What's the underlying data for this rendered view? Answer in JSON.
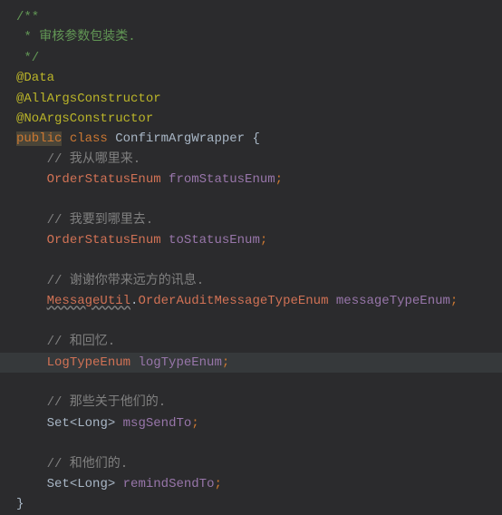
{
  "doc": {
    "open": "/**",
    "l1": " * 审核参数包装类.",
    "close": " */"
  },
  "ann": {
    "data": "@Data",
    "all": "@AllArgsConstructor",
    "no": "@NoArgsConstructor"
  },
  "decl": {
    "pub": "public",
    "cls": "class",
    "name": "ConfirmArgWrapper",
    "open": " {",
    "close": "}"
  },
  "f1": {
    "c": "    // 我从哪里来.",
    "type": "OrderStatusEnum",
    "name": "fromStatusEnum",
    "semi": ";"
  },
  "f2": {
    "c": "    // 我要到哪里去.",
    "type": "OrderStatusEnum",
    "name": "toStatusEnum",
    "semi": ";"
  },
  "f3": {
    "c": "    // 谢谢你带来远方的讯息.",
    "type1": "MessageUtil",
    "dot": ".",
    "type2": "OrderAuditMessageTypeEnum",
    "name": "messageTypeEnum",
    "semi": ";"
  },
  "f4": {
    "c": "    // 和回忆.",
    "type": "LogTypeEnum",
    "name": "logTypeEnum",
    "semi": ";"
  },
  "f5": {
    "c": "    // 那些关于他们的.",
    "type": "Set",
    "lt": "<",
    "gen": "Long",
    "gt": ">",
    "name": "msgSendTo",
    "semi": ";"
  },
  "f6": {
    "c": "    // 和他们的.",
    "type": "Set",
    "lt": "<",
    "gen": "Long",
    "gt": ">",
    "name": "remindSendTo",
    "semi": ";"
  },
  "indent": "    ",
  "space": " "
}
